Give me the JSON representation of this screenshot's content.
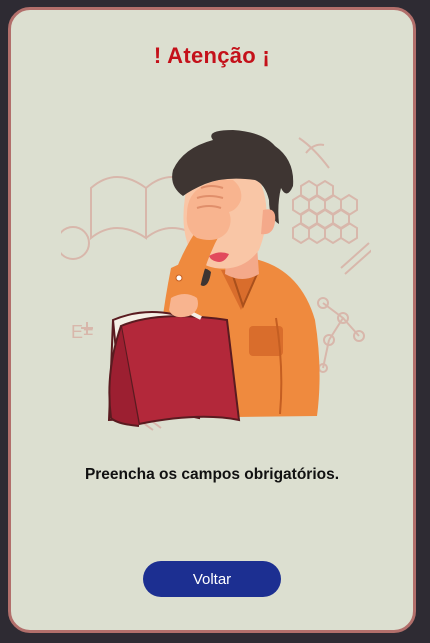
{
  "dialog": {
    "title": "! Atenção ¡",
    "message": "Preencha os campos obrigatórios.",
    "back_label": "Voltar",
    "illustration": "facepalm-person-with-book"
  },
  "colors": {
    "background": "#2e2b33",
    "card": "#dcdfd0",
    "card_border": "#b26f6b",
    "title": "#c4111a",
    "button": "#1c2f91"
  }
}
